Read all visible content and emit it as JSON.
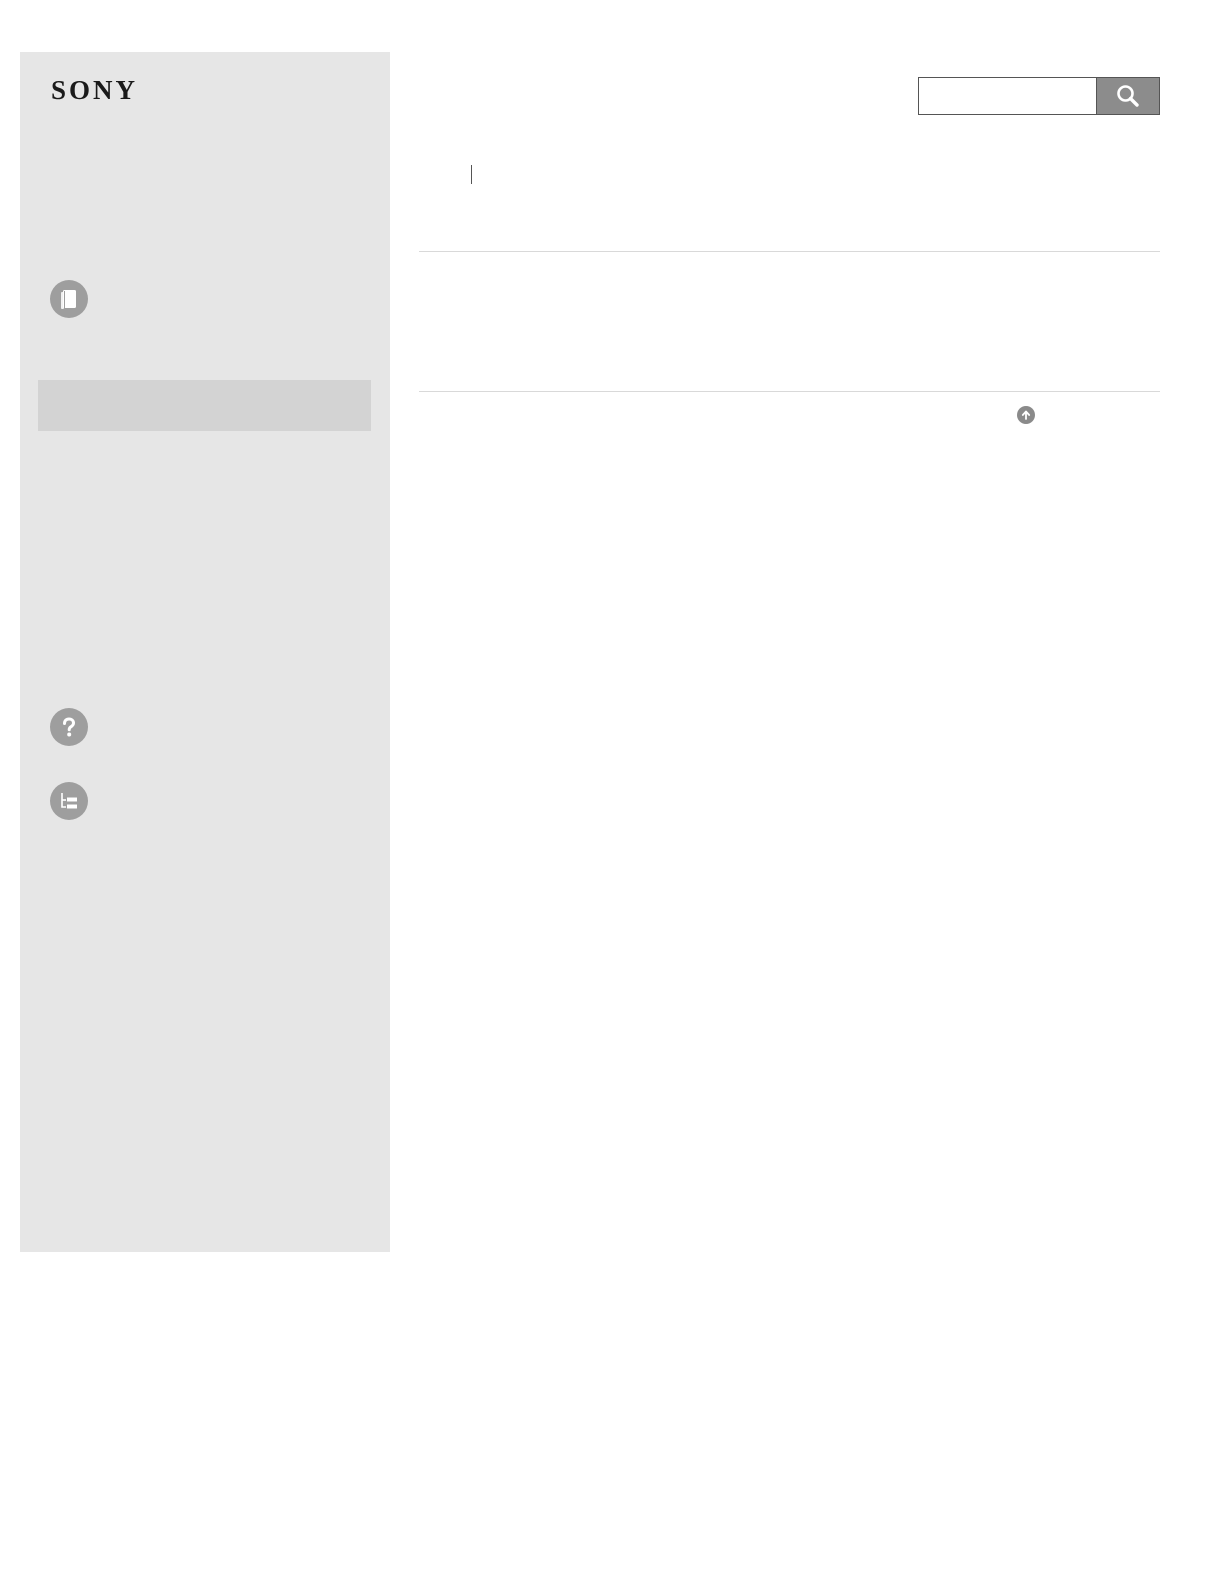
{
  "header": {
    "logo_text": "SONY"
  },
  "search": {
    "value": "",
    "placeholder": "",
    "button_icon": "magnifier-icon"
  },
  "sidebar": {
    "items": [
      {
        "icon": "book-icon"
      },
      {
        "icon": "help-icon"
      },
      {
        "icon": "index-icon"
      }
    ]
  },
  "page_top": {
    "icon": "arrow-up-circle-icon"
  },
  "colors": {
    "sidebar_bg": "#e6e6e6",
    "sidebar_highlight": "#d3d3d3",
    "icon_gray": "#9e9e9e",
    "search_button": "#8c8c8c",
    "rule": "#d9d9d9"
  }
}
